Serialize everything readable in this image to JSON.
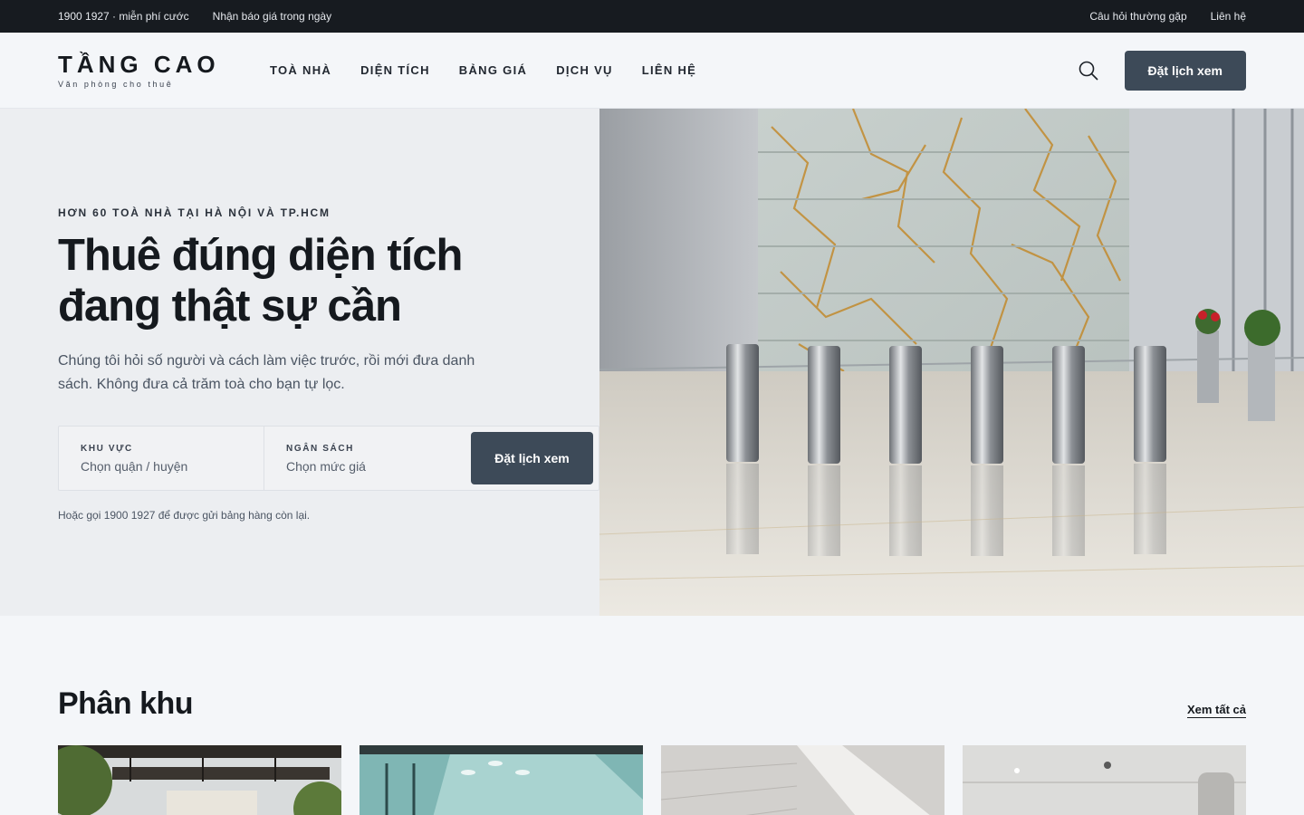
{
  "topbar": {
    "phone": "1900 1927 · miễn phí cước",
    "quote": "Nhận báo giá trong ngày",
    "faq": "Câu hỏi thường gặp",
    "contact": "Liên hệ"
  },
  "header": {
    "logo_main": "TẦNG CAO",
    "logo_sub": "Văn phòng cho thuê",
    "nav": [
      "TOÀ NHÀ",
      "DIỆN TÍCH",
      "BẢNG GIÁ",
      "DỊCH VỤ",
      "LIÊN HỆ"
    ],
    "search_icon": "search-icon",
    "cta": "Đặt lịch xem"
  },
  "hero": {
    "eyebrow": "HƠN 60 TOÀ NHÀ TẠI HÀ NỘI VÀ TP.HCM",
    "title": "Thuê đúng diện tích đang thật sự cần",
    "description": "Chúng tôi hỏi số người và cách làm việc trước, rồi mới đưa danh sách. Không đưa cả trăm toà cho bạn tự lọc.",
    "area_label": "KHU VỰC",
    "area_value": "Chọn quận / huyện",
    "budget_label": "NGÂN SÁCH",
    "budget_value": "Chọn mức giá",
    "search_cta": "Đặt lịch xem",
    "note": "Hoặc gọi 1900 1927 để được gửi bảng hàng còn lại."
  },
  "section": {
    "title": "Phân khu",
    "view_all": "Xem tất cả"
  },
  "colors": {
    "topbar_bg": "#171b20",
    "button_bg": "#3d4a58",
    "hero_left_bg": "#eceef1",
    "page_bg": "#f4f6f9"
  }
}
